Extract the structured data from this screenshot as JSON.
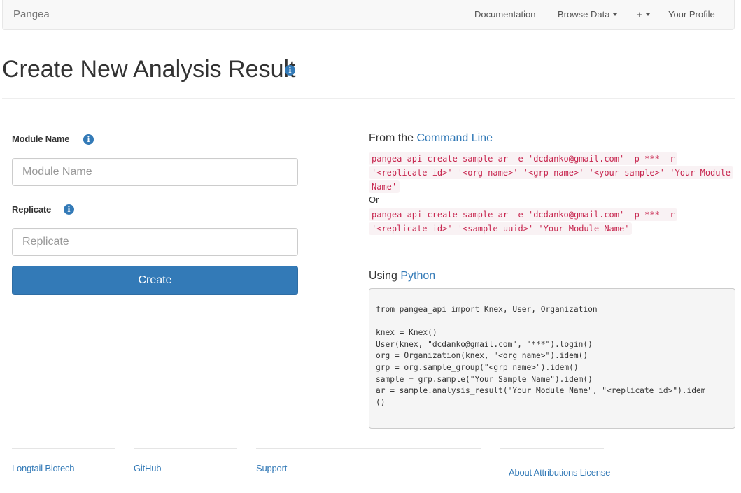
{
  "navbar": {
    "brand": "Pangea",
    "documentation": "Documentation",
    "browse_data": "Browse Data",
    "plus": "+",
    "your_profile": "Your Profile"
  },
  "page": {
    "title": "Create New Analysis Result"
  },
  "form": {
    "module_name_label": "Module Name",
    "module_name_placeholder": "Module Name",
    "module_name_value": "",
    "replicate_label": "Replicate",
    "replicate_placeholder": "Replicate",
    "replicate_value": "",
    "create_label": "Create"
  },
  "cli": {
    "heading_prefix": "From the ",
    "heading_link": "Command Line",
    "command1": "pangea-api create sample-ar -e 'dcdanko@gmail.com' -p *** -r '<replicate id>' '<org name>' '<grp name>' '<your sample>' 'Your Module Name'",
    "or_text": "Or",
    "command2": "pangea-api create sample-ar -e 'dcdanko@gmail.com' -p *** -r '<replicate id>' '<sample uuid>' 'Your Module Name'"
  },
  "python": {
    "heading_prefix": "Using ",
    "heading_link": "Python",
    "code": "from pangea_api import Knex, User, Organization\n\nknex = Knex()\nUser(knex, \"dcdanko@gmail.com\", \"***\").login()\norg = Organization(knex, \"<org name>\").idem()\ngrp = org.sample_group(\"<grp name>\").idem()\nsample = grp.sample(\"Your Sample Name\").idem()\nar = sample.analysis_result(\"Your Module Name\", \"<replicate id>\").idem\n()"
  },
  "footer": {
    "longtail": "Longtail Biotech",
    "github": "GitHub",
    "support": "Support",
    "about": "About Attributions License"
  },
  "icons": {
    "info": "info-icon",
    "caret": "caret-down-icon"
  },
  "colors": {
    "primary": "#337ab7",
    "code_text": "#c7254e",
    "code_bg": "#f9f2f4"
  }
}
